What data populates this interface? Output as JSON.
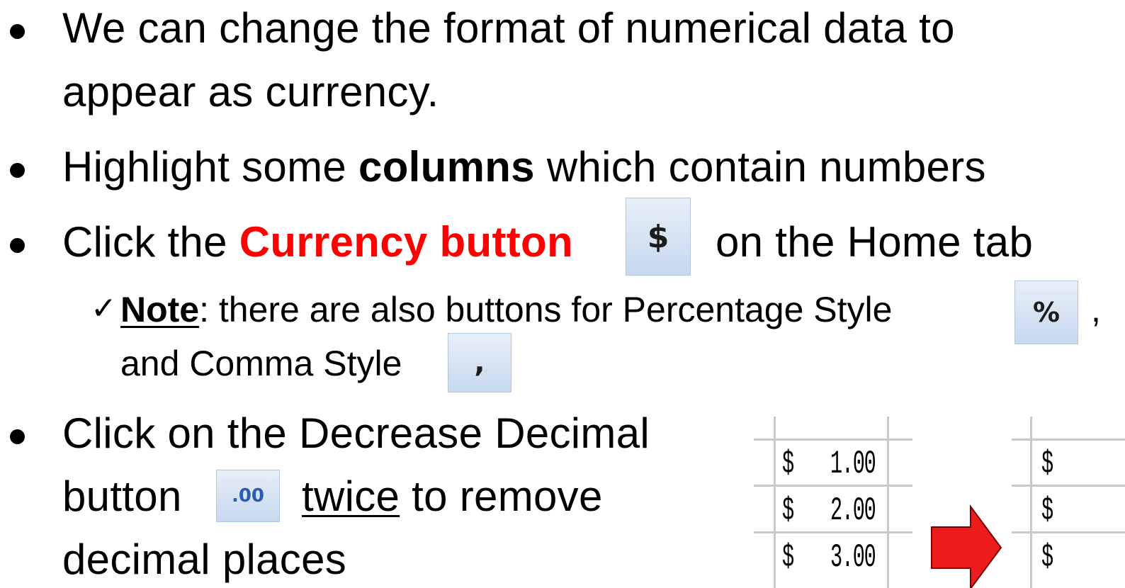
{
  "bullets": {
    "b1": {
      "line1": "We can change the format of numerical data to",
      "line2": "appear as currency."
    },
    "b2": {
      "pre": "Highlight some ",
      "bold": "columns",
      "post": " which contain numbers"
    },
    "b3": {
      "pre": "Click the ",
      "red": "Currency button",
      "post": "on the Home tab",
      "icon_glyph": "$"
    },
    "note": {
      "check": "✓",
      "label": "Note",
      "text": ": there are also buttons for Percentage Style",
      "comma_after": ",",
      "line2": "and Comma Style",
      "percent_glyph": "%",
      "comma_glyph": ","
    },
    "b4": {
      "line1": "Click on the Decrease Decimal",
      "line2_pre": "button",
      "line2_ul": "twice",
      "line2_post": " to remove",
      "line3": "decimal places",
      "icon_glyph": ".00"
    }
  },
  "sheet_before": {
    "rows": [
      {
        "symbol": "$",
        "value": "1.00"
      },
      {
        "symbol": "$",
        "value": "2.00"
      },
      {
        "symbol": "$",
        "value": "3.00"
      }
    ]
  },
  "sheet_after": {
    "rows": [
      {
        "symbol": "$"
      },
      {
        "symbol": "$"
      },
      {
        "symbol": "$"
      }
    ]
  },
  "colors": {
    "accent_red": "#ff0000",
    "arrow_fill": "#ee1c1c",
    "grid": "#c9c9c9"
  }
}
